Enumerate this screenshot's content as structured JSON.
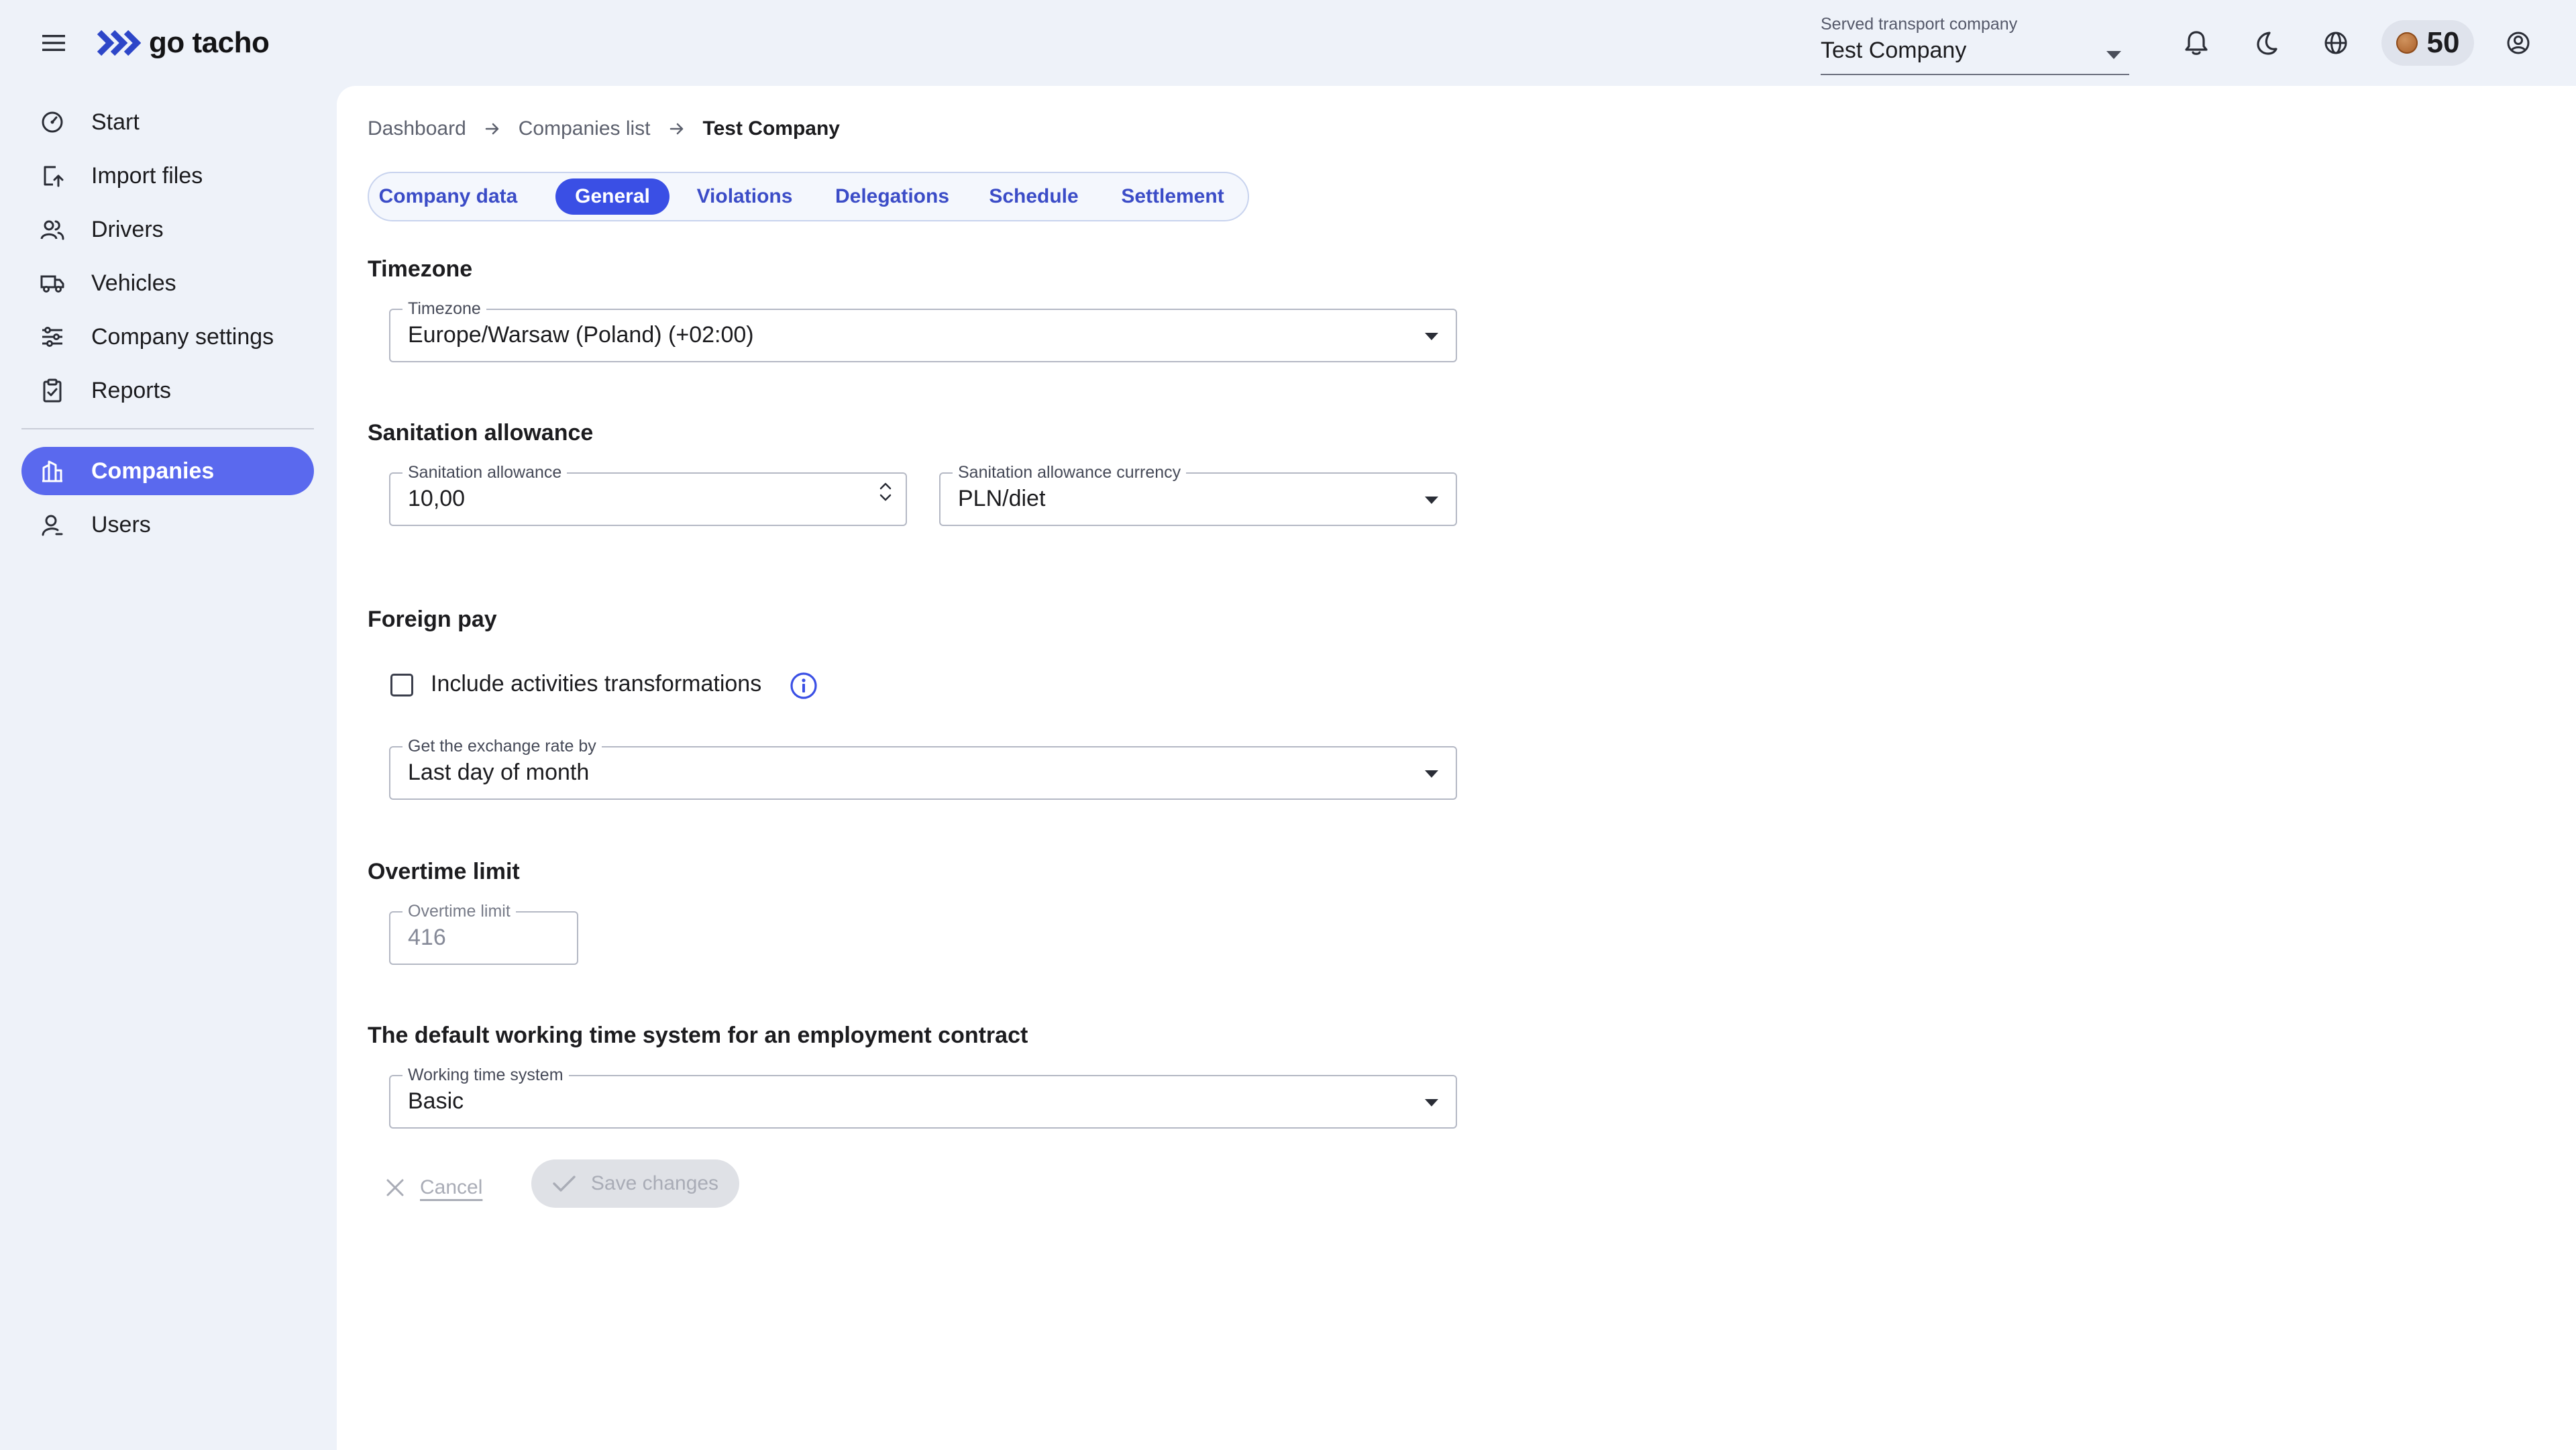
{
  "header": {
    "logo_text": "go tacho",
    "company_select": {
      "label": "Served transport company",
      "value": "Test Company"
    },
    "coins": "50"
  },
  "sidebar": {
    "items": [
      {
        "label": "Start",
        "icon": "gauge-icon"
      },
      {
        "label": "Import files",
        "icon": "file-upload-icon"
      },
      {
        "label": "Drivers",
        "icon": "people-icon"
      },
      {
        "label": "Vehicles",
        "icon": "truck-icon"
      },
      {
        "label": "Company settings",
        "icon": "sliders-icon"
      },
      {
        "label": "Reports",
        "icon": "clipboard-icon"
      }
    ],
    "admin_items": [
      {
        "label": "Companies",
        "icon": "buildings-icon",
        "active": true
      },
      {
        "label": "Users",
        "icon": "user-icon"
      }
    ]
  },
  "breadcrumb": [
    "Dashboard",
    "Companies list",
    "Test Company"
  ],
  "tabs": [
    {
      "label": "Company data"
    },
    {
      "label": "General",
      "active": true
    },
    {
      "label": "Violations"
    },
    {
      "label": "Delegations"
    },
    {
      "label": "Schedule"
    },
    {
      "label": "Settlement"
    }
  ],
  "form": {
    "timezone": {
      "section": "Timezone",
      "label": "Timezone",
      "value": "Europe/Warsaw (Poland) (+02:00)"
    },
    "sanitation": {
      "section": "Sanitation allowance",
      "amount_label": "Sanitation allowance",
      "amount_value": "10,00",
      "currency_label": "Sanitation allowance currency",
      "currency_value": "PLN/diet"
    },
    "foreign_pay": {
      "section": "Foreign pay",
      "checkbox_label": "Include activities transformations",
      "checkbox_checked": false,
      "exchange_label": "Get the exchange rate by",
      "exchange_value": "Last day of month"
    },
    "overtime": {
      "section": "Overtime limit",
      "label": "Overtime limit",
      "value": "416"
    },
    "working_time": {
      "section": "The default working time system for an employment contract",
      "label": "Working time system",
      "value": "Basic"
    }
  },
  "actions": {
    "cancel": "Cancel",
    "save": "Save changes"
  },
  "colors": {
    "accent": "#3a4fe5",
    "sidebar_active": "#5a69ee",
    "background": "#eef2f9"
  }
}
